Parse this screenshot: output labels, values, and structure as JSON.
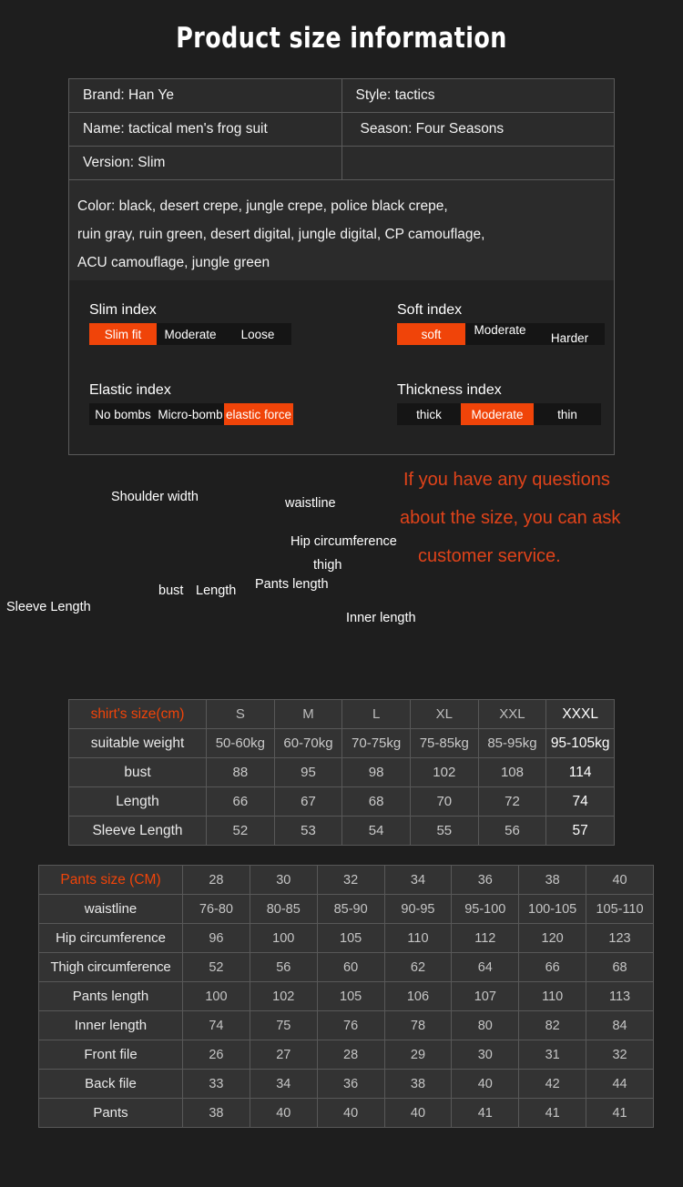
{
  "title": "Product size information",
  "info": {
    "rows": [
      {
        "left": "Brand: Han Ye",
        "right": "Style: tactics"
      },
      {
        "left": "Name: tactical men's frog suit",
        "right": "Season: Four Seasons"
      },
      {
        "left": "Version: Slim",
        "right": ""
      }
    ],
    "color_line_1": "Color: black, desert crepe, jungle crepe, police black crepe,",
    "color_line_2": "ruin gray, ruin green, desert digital, jungle digital, CP camouflage,",
    "color_line_3": "ACU camouflage, jungle green"
  },
  "indexes": {
    "accent_color": "#f04409",
    "slim": {
      "title": "Slim index",
      "segments": [
        "Slim fit",
        "Moderate",
        "Loose"
      ],
      "selected": 0
    },
    "soft": {
      "title": "Soft index",
      "segments": [
        "soft",
        "Moderate",
        "Harder"
      ],
      "selected": 0
    },
    "elastic": {
      "title": "Elastic index",
      "segments": [
        "No bombs",
        "Micro-bomb",
        "elastic force"
      ],
      "selected": 2
    },
    "thickness": {
      "title": "Thickness index",
      "segments": [
        "thick",
        "Moderate",
        "thin"
      ],
      "selected": 1
    }
  },
  "diagram": {
    "shirt_labels": {
      "shoulder_width": "Shoulder width",
      "sleeve_length": "Sleeve Length",
      "bust": "bust",
      "length": "Length"
    },
    "pants_labels": {
      "waistline": "waistline",
      "hip_circumference": "Hip circumference",
      "thigh": "thigh",
      "pants_length": "Pants length",
      "inner_length": "Inner length"
    },
    "note_line_1": "If you have any questions",
    "note_line_2": "about the size, you can ask",
    "note_line_3": "customer service.",
    "note_color": "#e0431a",
    "outline_color": "#8f9296",
    "dimension_color": "#b4682a"
  },
  "shirt_table": {
    "header": [
      "shirt's size(cm)",
      "S",
      "M",
      "L",
      "XL",
      "XXL",
      "XXXL"
    ],
    "rows": [
      {
        "label": "suitable weight",
        "values": [
          "50-60kg",
          "60-70kg",
          "70-75kg",
          "75-85kg",
          "85-95kg",
          "95-105kg"
        ]
      },
      {
        "label": "bust",
        "values": [
          "88",
          "95",
          "98",
          "102",
          "108",
          "114"
        ]
      },
      {
        "label": "Length",
        "values": [
          "66",
          "67",
          "68",
          "70",
          "72",
          "74"
        ]
      },
      {
        "label": "Sleeve Length",
        "values": [
          "52",
          "53",
          "54",
          "55",
          "56",
          "57"
        ]
      }
    ]
  },
  "pants_table": {
    "header": [
      "Pants size (CM)",
      "28",
      "30",
      "32",
      "34",
      "36",
      "38",
      "40"
    ],
    "rows": [
      {
        "label": "waistline",
        "values": [
          "76-80",
          "80-85",
          "85-90",
          "90-95",
          "95-100",
          "100-105",
          "105-110"
        ]
      },
      {
        "label": "Hip circumference",
        "values": [
          "96",
          "100",
          "105",
          "110",
          "112",
          "120",
          "123"
        ]
      },
      {
        "label": "Thigh circumference",
        "values": [
          "52",
          "56",
          "60",
          "62",
          "64",
          "66",
          "68"
        ]
      },
      {
        "label": "Pants length",
        "values": [
          "100",
          "102",
          "105",
          "106",
          "107",
          "110",
          "113"
        ]
      },
      {
        "label": "Inner length",
        "values": [
          "74",
          "75",
          "76",
          "78",
          "80",
          "82",
          "84"
        ]
      },
      {
        "label": "Front file",
        "values": [
          "26",
          "27",
          "28",
          "29",
          "30",
          "31",
          "32"
        ]
      },
      {
        "label": "Back file",
        "values": [
          "33",
          "34",
          "36",
          "38",
          "40",
          "42",
          "44"
        ]
      },
      {
        "label": "Pants",
        "values": [
          "38",
          "40",
          "40",
          "40",
          "41",
          "41",
          "41"
        ]
      }
    ]
  }
}
